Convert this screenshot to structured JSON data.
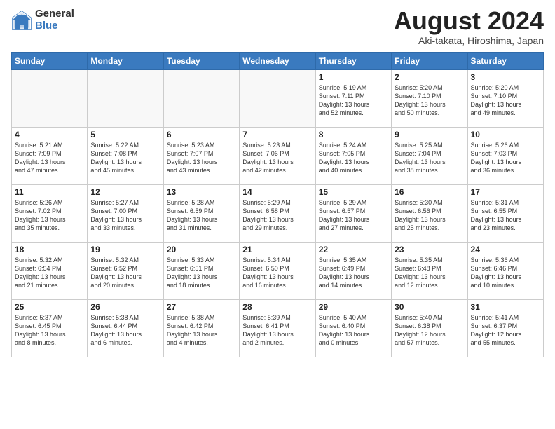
{
  "header": {
    "logo_general": "General",
    "logo_blue": "Blue",
    "title": "August 2024",
    "location": "Aki-takata, Hiroshima, Japan"
  },
  "weekdays": [
    "Sunday",
    "Monday",
    "Tuesday",
    "Wednesday",
    "Thursday",
    "Friday",
    "Saturday"
  ],
  "weeks": [
    [
      {
        "day": "",
        "info": ""
      },
      {
        "day": "",
        "info": ""
      },
      {
        "day": "",
        "info": ""
      },
      {
        "day": "",
        "info": ""
      },
      {
        "day": "1",
        "info": "Sunrise: 5:19 AM\nSunset: 7:11 PM\nDaylight: 13 hours\nand 52 minutes."
      },
      {
        "day": "2",
        "info": "Sunrise: 5:20 AM\nSunset: 7:10 PM\nDaylight: 13 hours\nand 50 minutes."
      },
      {
        "day": "3",
        "info": "Sunrise: 5:20 AM\nSunset: 7:10 PM\nDaylight: 13 hours\nand 49 minutes."
      }
    ],
    [
      {
        "day": "4",
        "info": "Sunrise: 5:21 AM\nSunset: 7:09 PM\nDaylight: 13 hours\nand 47 minutes."
      },
      {
        "day": "5",
        "info": "Sunrise: 5:22 AM\nSunset: 7:08 PM\nDaylight: 13 hours\nand 45 minutes."
      },
      {
        "day": "6",
        "info": "Sunrise: 5:23 AM\nSunset: 7:07 PM\nDaylight: 13 hours\nand 43 minutes."
      },
      {
        "day": "7",
        "info": "Sunrise: 5:23 AM\nSunset: 7:06 PM\nDaylight: 13 hours\nand 42 minutes."
      },
      {
        "day": "8",
        "info": "Sunrise: 5:24 AM\nSunset: 7:05 PM\nDaylight: 13 hours\nand 40 minutes."
      },
      {
        "day": "9",
        "info": "Sunrise: 5:25 AM\nSunset: 7:04 PM\nDaylight: 13 hours\nand 38 minutes."
      },
      {
        "day": "10",
        "info": "Sunrise: 5:26 AM\nSunset: 7:03 PM\nDaylight: 13 hours\nand 36 minutes."
      }
    ],
    [
      {
        "day": "11",
        "info": "Sunrise: 5:26 AM\nSunset: 7:02 PM\nDaylight: 13 hours\nand 35 minutes."
      },
      {
        "day": "12",
        "info": "Sunrise: 5:27 AM\nSunset: 7:00 PM\nDaylight: 13 hours\nand 33 minutes."
      },
      {
        "day": "13",
        "info": "Sunrise: 5:28 AM\nSunset: 6:59 PM\nDaylight: 13 hours\nand 31 minutes."
      },
      {
        "day": "14",
        "info": "Sunrise: 5:29 AM\nSunset: 6:58 PM\nDaylight: 13 hours\nand 29 minutes."
      },
      {
        "day": "15",
        "info": "Sunrise: 5:29 AM\nSunset: 6:57 PM\nDaylight: 13 hours\nand 27 minutes."
      },
      {
        "day": "16",
        "info": "Sunrise: 5:30 AM\nSunset: 6:56 PM\nDaylight: 13 hours\nand 25 minutes."
      },
      {
        "day": "17",
        "info": "Sunrise: 5:31 AM\nSunset: 6:55 PM\nDaylight: 13 hours\nand 23 minutes."
      }
    ],
    [
      {
        "day": "18",
        "info": "Sunrise: 5:32 AM\nSunset: 6:54 PM\nDaylight: 13 hours\nand 21 minutes."
      },
      {
        "day": "19",
        "info": "Sunrise: 5:32 AM\nSunset: 6:52 PM\nDaylight: 13 hours\nand 20 minutes."
      },
      {
        "day": "20",
        "info": "Sunrise: 5:33 AM\nSunset: 6:51 PM\nDaylight: 13 hours\nand 18 minutes."
      },
      {
        "day": "21",
        "info": "Sunrise: 5:34 AM\nSunset: 6:50 PM\nDaylight: 13 hours\nand 16 minutes."
      },
      {
        "day": "22",
        "info": "Sunrise: 5:35 AM\nSunset: 6:49 PM\nDaylight: 13 hours\nand 14 minutes."
      },
      {
        "day": "23",
        "info": "Sunrise: 5:35 AM\nSunset: 6:48 PM\nDaylight: 13 hours\nand 12 minutes."
      },
      {
        "day": "24",
        "info": "Sunrise: 5:36 AM\nSunset: 6:46 PM\nDaylight: 13 hours\nand 10 minutes."
      }
    ],
    [
      {
        "day": "25",
        "info": "Sunrise: 5:37 AM\nSunset: 6:45 PM\nDaylight: 13 hours\nand 8 minutes."
      },
      {
        "day": "26",
        "info": "Sunrise: 5:38 AM\nSunset: 6:44 PM\nDaylight: 13 hours\nand 6 minutes."
      },
      {
        "day": "27",
        "info": "Sunrise: 5:38 AM\nSunset: 6:42 PM\nDaylight: 13 hours\nand 4 minutes."
      },
      {
        "day": "28",
        "info": "Sunrise: 5:39 AM\nSunset: 6:41 PM\nDaylight: 13 hours\nand 2 minutes."
      },
      {
        "day": "29",
        "info": "Sunrise: 5:40 AM\nSunset: 6:40 PM\nDaylight: 13 hours\nand 0 minutes."
      },
      {
        "day": "30",
        "info": "Sunrise: 5:40 AM\nSunset: 6:38 PM\nDaylight: 12 hours\nand 57 minutes."
      },
      {
        "day": "31",
        "info": "Sunrise: 5:41 AM\nSunset: 6:37 PM\nDaylight: 12 hours\nand 55 minutes."
      }
    ]
  ]
}
